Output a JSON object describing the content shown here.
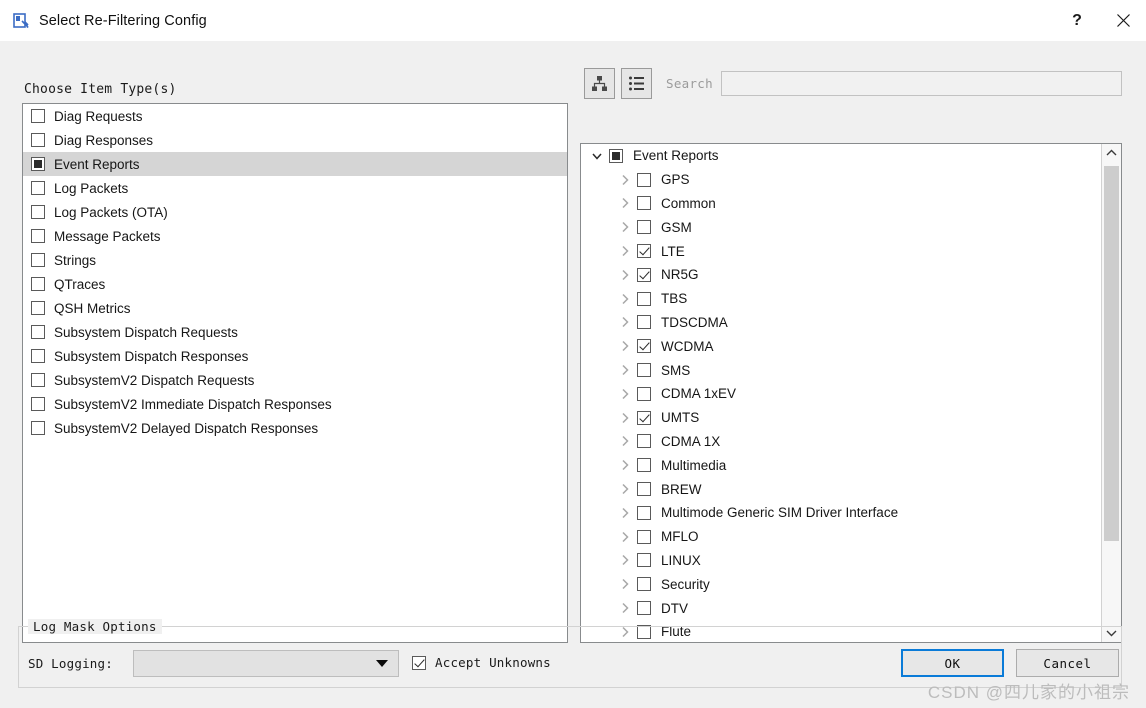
{
  "window": {
    "title": "Select Re-Filtering Config",
    "icon": "app-filter-icon",
    "help_label": "?",
    "close_label": "×"
  },
  "left_panel": {
    "label": "Choose Item Type(s)",
    "items": [
      {
        "label": "Diag Requests",
        "state": "unchecked",
        "selected": false
      },
      {
        "label": "Diag Responses",
        "state": "unchecked",
        "selected": false
      },
      {
        "label": "Event Reports",
        "state": "partial",
        "selected": true
      },
      {
        "label": "Log Packets",
        "state": "unchecked",
        "selected": false
      },
      {
        "label": "Log Packets (OTA)",
        "state": "unchecked",
        "selected": false
      },
      {
        "label": "Message Packets",
        "state": "unchecked",
        "selected": false
      },
      {
        "label": "Strings",
        "state": "unchecked",
        "selected": false
      },
      {
        "label": "QTraces",
        "state": "unchecked",
        "selected": false
      },
      {
        "label": "QSH Metrics",
        "state": "unchecked",
        "selected": false
      },
      {
        "label": "Subsystem Dispatch Requests",
        "state": "unchecked",
        "selected": false
      },
      {
        "label": "Subsystem Dispatch Responses",
        "state": "unchecked",
        "selected": false
      },
      {
        "label": "SubsystemV2 Dispatch Requests",
        "state": "unchecked",
        "selected": false
      },
      {
        "label": "SubsystemV2 Immediate Dispatch Responses",
        "state": "unchecked",
        "selected": false
      },
      {
        "label": "SubsystemV2 Delayed Dispatch Responses",
        "state": "unchecked",
        "selected": false
      }
    ]
  },
  "right_panel": {
    "toolbar": {
      "tree_view_button": "tree-view-icon",
      "list_view_button": "list-view-icon",
      "search_label": "Search",
      "search_value": "",
      "search_placeholder": ""
    },
    "tree": [
      {
        "label": "Event Reports",
        "state": "partial",
        "depth": 0,
        "expander": "expanded"
      },
      {
        "label": "GPS",
        "state": "unchecked",
        "depth": 1,
        "expander": "collapsed"
      },
      {
        "label": "Common",
        "state": "unchecked",
        "depth": 1,
        "expander": "collapsed"
      },
      {
        "label": "GSM",
        "state": "unchecked",
        "depth": 1,
        "expander": "collapsed"
      },
      {
        "label": "LTE",
        "state": "checked",
        "depth": 1,
        "expander": "collapsed"
      },
      {
        "label": "NR5G",
        "state": "checked",
        "depth": 1,
        "expander": "collapsed"
      },
      {
        "label": "TBS",
        "state": "unchecked",
        "depth": 1,
        "expander": "collapsed"
      },
      {
        "label": "TDSCDMA",
        "state": "unchecked",
        "depth": 1,
        "expander": "collapsed"
      },
      {
        "label": "WCDMA",
        "state": "checked",
        "depth": 1,
        "expander": "collapsed"
      },
      {
        "label": "SMS",
        "state": "unchecked",
        "depth": 1,
        "expander": "collapsed"
      },
      {
        "label": "CDMA 1xEV",
        "state": "unchecked",
        "depth": 1,
        "expander": "collapsed"
      },
      {
        "label": "UMTS",
        "state": "checked",
        "depth": 1,
        "expander": "collapsed"
      },
      {
        "label": "CDMA 1X",
        "state": "unchecked",
        "depth": 1,
        "expander": "collapsed"
      },
      {
        "label": "Multimedia",
        "state": "unchecked",
        "depth": 1,
        "expander": "collapsed"
      },
      {
        "label": "BREW",
        "state": "unchecked",
        "depth": 1,
        "expander": "collapsed"
      },
      {
        "label": "Multimode Generic SIM Driver Interface",
        "state": "unchecked",
        "depth": 1,
        "expander": "collapsed"
      },
      {
        "label": "MFLO",
        "state": "unchecked",
        "depth": 1,
        "expander": "collapsed"
      },
      {
        "label": "LINUX",
        "state": "unchecked",
        "depth": 1,
        "expander": "collapsed"
      },
      {
        "label": "Security",
        "state": "unchecked",
        "depth": 1,
        "expander": "collapsed"
      },
      {
        "label": "DTV",
        "state": "unchecked",
        "depth": 1,
        "expander": "collapsed"
      },
      {
        "label": "Flute",
        "state": "unchecked",
        "depth": 1,
        "expander": "collapsed"
      }
    ]
  },
  "log_mask_options": {
    "group_title": "Log Mask Options",
    "sd_logging_label": "SD Logging:",
    "sd_logging_value": "",
    "accept_unknowns_label": "Accept Unknowns",
    "accept_unknowns_state": "checked"
  },
  "footer": {
    "ok_label": "OK",
    "cancel_label": "Cancel"
  },
  "watermark": "CSDN @四儿家的小祖宗",
  "colors": {
    "focus_border": "#0a7bd8",
    "selection": "#d5d5d5",
    "panel_bg": "#f0f0f0",
    "list_bg": "#ffffff"
  }
}
